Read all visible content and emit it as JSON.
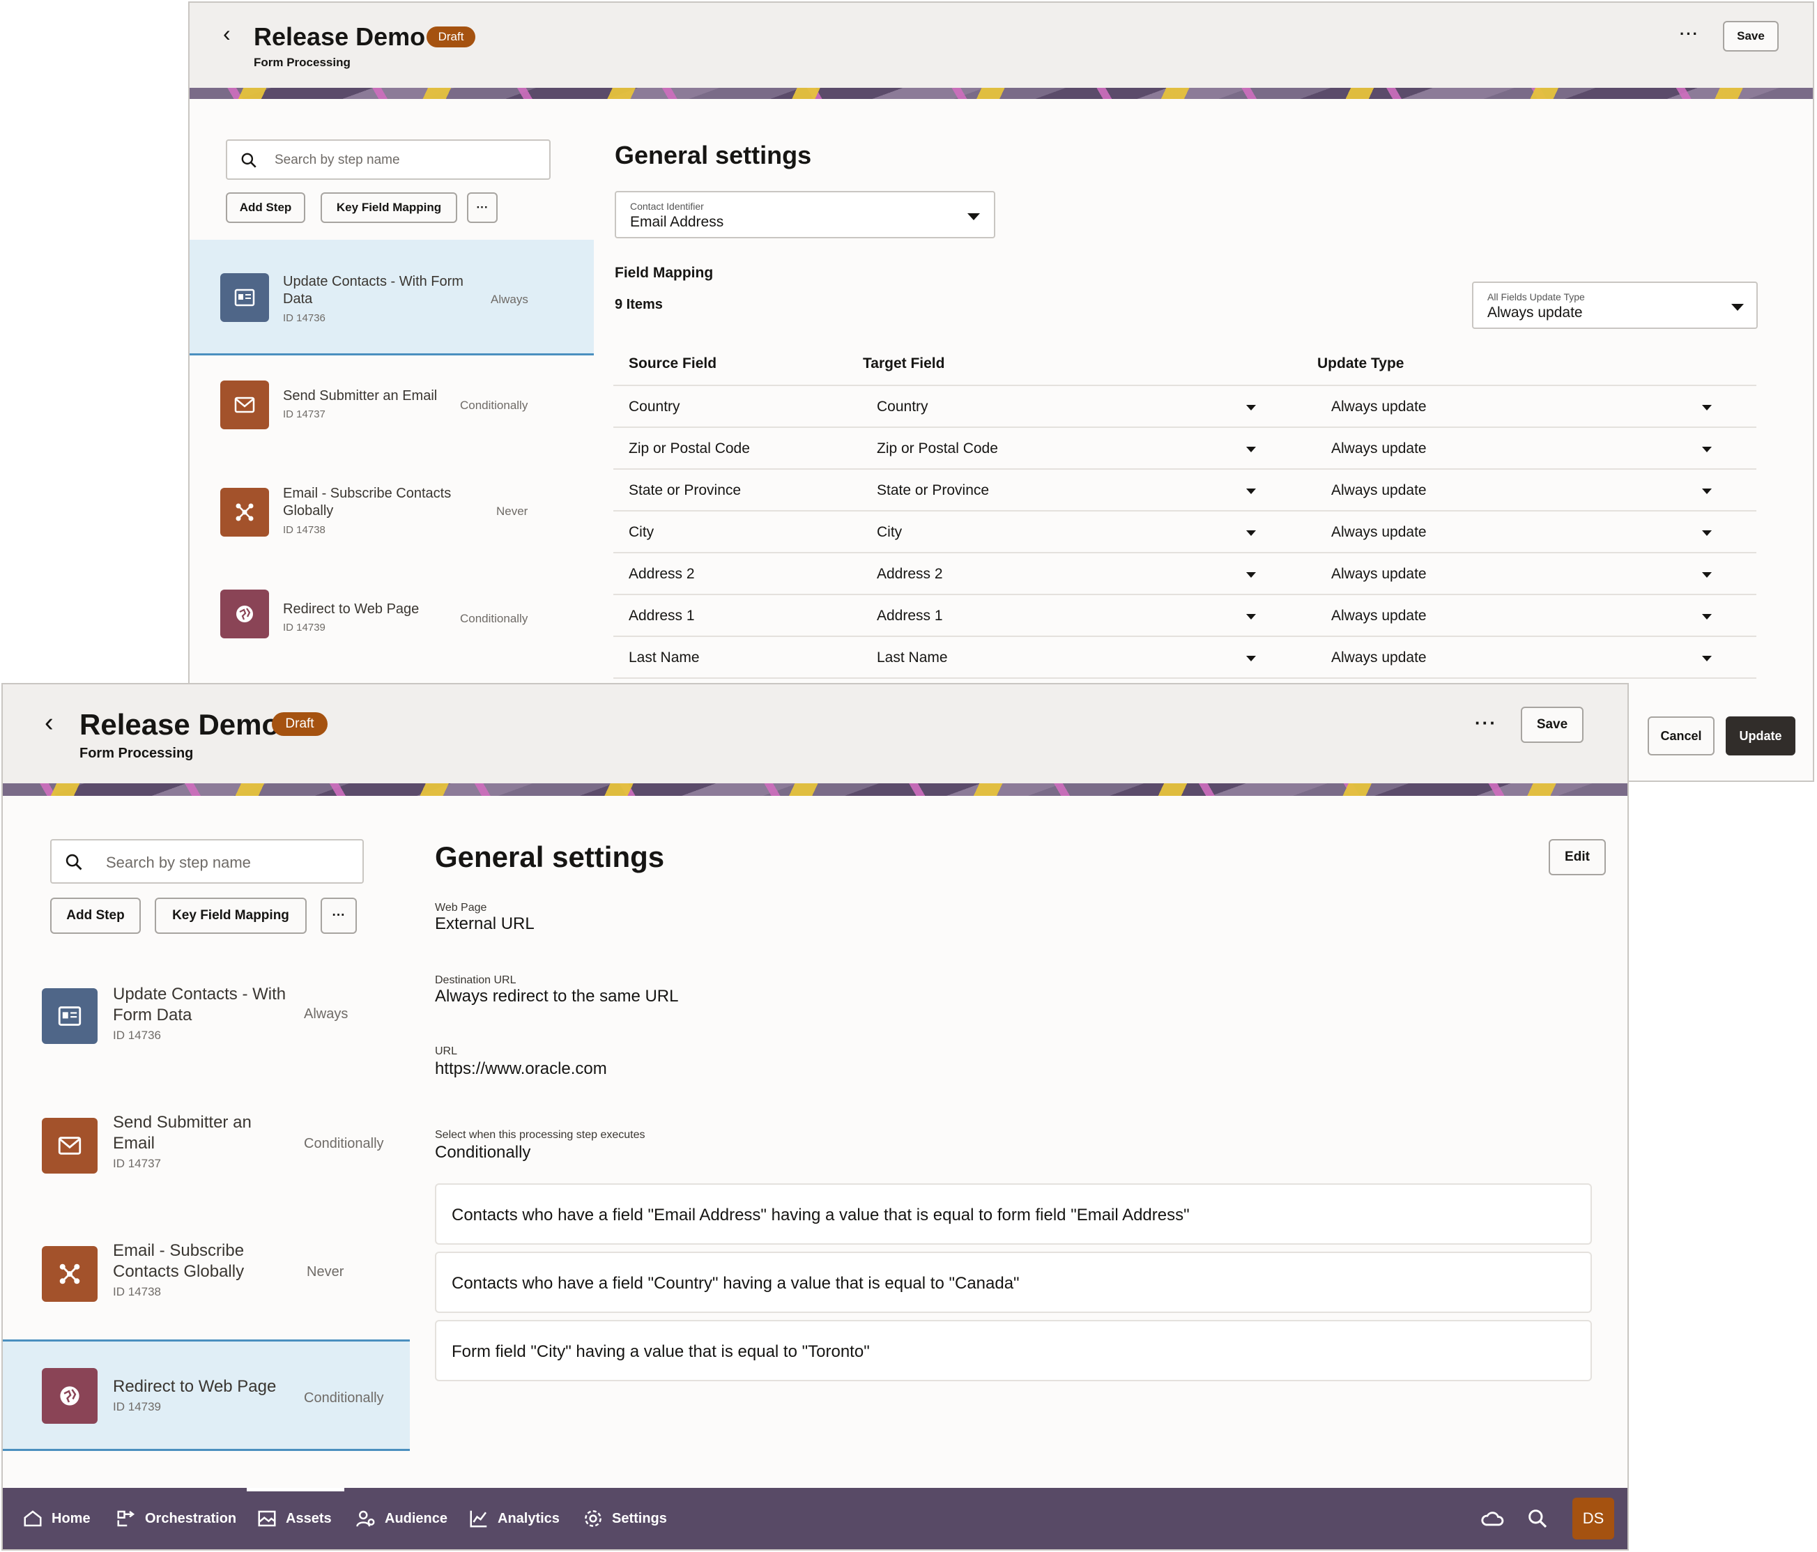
{
  "app": {
    "title": "Release Demo",
    "badge": "Draft",
    "subtitle": "Form Processing",
    "more": "···",
    "save_label": "Save"
  },
  "sidebar": {
    "search_placeholder": "Search by step name",
    "add_step_label": "Add Step",
    "key_field_mapping_label": "Key Field Mapping",
    "more": "···",
    "steps": [
      {
        "name": "Update Contacts - With Form Data",
        "id": "ID 14736",
        "condition": "Always",
        "icon": "contact-card-icon",
        "color": "#4f6688"
      },
      {
        "name": "Send Submitter an Email",
        "id": "ID 14737",
        "condition": "Conditionally",
        "icon": "envelope-icon",
        "color": "#a3522b"
      },
      {
        "name": "Email - Subscribe Contacts Globally",
        "id": "ID 14738",
        "condition": "Never",
        "icon": "network-icon",
        "color": "#a3522b"
      },
      {
        "name": "Redirect to Web Page",
        "id": "ID 14739",
        "condition": "Conditionally",
        "icon": "web-globe-icon",
        "color": "#8a4456"
      }
    ]
  },
  "back_panel": {
    "heading": "General settings",
    "contact_identifier": {
      "label": "Contact Identifier",
      "value": "Email Address"
    },
    "field_mapping_title": "Field Mapping",
    "items_count": "9 Items",
    "all_fields_update": {
      "label": "All Fields Update Type",
      "value": "Always update"
    },
    "columns": {
      "source": "Source Field",
      "target": "Target Field",
      "update": "Update Type"
    },
    "rows": [
      {
        "source": "Country",
        "target": "Country",
        "update": "Always update"
      },
      {
        "source": "Zip or Postal Code",
        "target": "Zip or Postal Code",
        "update": "Always update"
      },
      {
        "source": "State or Province",
        "target": "State or Province",
        "update": "Always update"
      },
      {
        "source": "City",
        "target": "City",
        "update": "Always update"
      },
      {
        "source": "Address 2",
        "target": "Address 2",
        "update": "Always update"
      },
      {
        "source": "Address 1",
        "target": "Address 1",
        "update": "Always update"
      },
      {
        "source": "Last Name",
        "target": "Last Name",
        "update": "Always update"
      }
    ],
    "cancel_label": "Cancel",
    "update_label": "Update"
  },
  "front_panel": {
    "heading": "General settings",
    "edit_label": "Edit",
    "fields": [
      {
        "label": "Web Page",
        "value": "External URL"
      },
      {
        "label": "Destination URL",
        "value": "Always redirect to the same URL"
      },
      {
        "label": "URL",
        "value": "https://www.oracle.com"
      },
      {
        "label": "Select when this processing step executes",
        "value": "Conditionally"
      }
    ],
    "rules": [
      "Contacts who have a field \"Email Address\" having a value that is equal to form field \"Email Address\"",
      "Contacts who have a field \"Country\" having a value that is equal to \"Canada\"",
      "Form field \"City\" having a value that is equal to \"Toronto\""
    ]
  },
  "nav": {
    "items": [
      {
        "label": "Home",
        "icon": "home-icon"
      },
      {
        "label": "Orchestration",
        "icon": "orchestration-icon"
      },
      {
        "label": "Assets",
        "icon": "assets-icon"
      },
      {
        "label": "Audience",
        "icon": "audience-icon"
      },
      {
        "label": "Analytics",
        "icon": "analytics-icon"
      },
      {
        "label": "Settings",
        "icon": "gear-icon"
      }
    ],
    "avatar": "DS"
  }
}
